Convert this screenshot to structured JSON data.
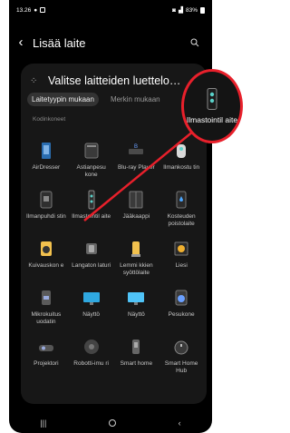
{
  "status": {
    "time": "13.26",
    "right": "83%"
  },
  "header": {
    "title": "Lisää laite"
  },
  "card": {
    "title": "Valitse laitteiden luettelo…"
  },
  "tabs": [
    {
      "label": "Laitetyypin mukaan"
    },
    {
      "label": "Merkin mukaan"
    }
  ],
  "section": "Kodinkoneet",
  "devices": [
    {
      "label": "AirDresser",
      "icon": "airdresser-icon"
    },
    {
      "label": "Astianpesu kone",
      "icon": "dishwasher-icon"
    },
    {
      "label": "Blu-ray Player",
      "icon": "bluray-icon"
    },
    {
      "label": "Ilmankostu tin",
      "icon": "humidifier-icon"
    },
    {
      "label": "Ilmanpuhdi stin",
      "icon": "air-purifier-icon"
    },
    {
      "label": "Ilmastointil aite",
      "icon": "air-conditioner-icon"
    },
    {
      "label": "Jääkaappi",
      "icon": "fridge-icon"
    },
    {
      "label": "Kosteuden poistolaite",
      "icon": "dehumidifier-icon"
    },
    {
      "label": "Kuivauskon e",
      "icon": "dryer-icon"
    },
    {
      "label": "Langaton laturi",
      "icon": "wireless-charger-icon"
    },
    {
      "label": "Lemmi kkien syöttölaite",
      "icon": "pet-feeder-icon"
    },
    {
      "label": "Liesi",
      "icon": "stove-icon"
    },
    {
      "label": "Mikrokuitus uodatin",
      "icon": "microfiber-filter-icon"
    },
    {
      "label": "Näyttö",
      "icon": "monitor-icon"
    },
    {
      "label": "Näyttö",
      "icon": "display-icon"
    },
    {
      "label": "Pesukone",
      "icon": "washer-icon"
    },
    {
      "label": "Projektori",
      "icon": "projector-icon"
    },
    {
      "label": "Robotti-imu ri",
      "icon": "robot-vacuum-icon"
    },
    {
      "label": "Smart home",
      "icon": "smart-home-icon"
    },
    {
      "label": "Smart Home Hub",
      "icon": "smart-home-hub-icon"
    }
  ],
  "zoom": {
    "label": "Ilmastointil aite",
    "icon": "air-conditioner-icon"
  },
  "colors": {
    "background": "#000000",
    "card": "#171717",
    "highlight": "#e8202b"
  }
}
